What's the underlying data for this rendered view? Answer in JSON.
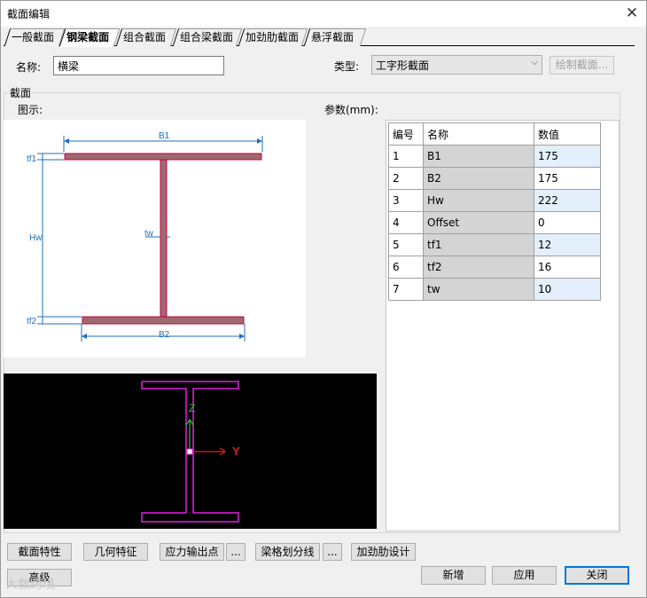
{
  "window": {
    "title": "截面编辑",
    "close": "✕"
  },
  "tabs": [
    {
      "label": "一般截面",
      "active": false
    },
    {
      "label": "钢梁截面",
      "active": true
    },
    {
      "label": "组合截面",
      "active": false
    },
    {
      "label": "组合梁截面",
      "active": false
    },
    {
      "label": "加劲肋截面",
      "active": false
    },
    {
      "label": "悬浮截面",
      "active": false
    }
  ],
  "name_field": {
    "label": "名称:",
    "value": "横梁"
  },
  "type_field": {
    "label": "类型:",
    "value": "工字形截面"
  },
  "draw_section_button": "绘制截面...",
  "section_group": {
    "title": "截面",
    "diagram_label": "图示:",
    "params_label": "参数(mm):"
  },
  "diagram": {
    "dims": {
      "B1": "B1",
      "B2": "B2",
      "Hw": "Hw",
      "tw": "tw",
      "tf1": "tf1",
      "tf2": "tf2"
    },
    "colors": {
      "flange": "#9c6a6f",
      "outline": "#cc0044",
      "dim": "#1e6fbf"
    }
  },
  "view3d": {
    "axis_z": "Z",
    "axis_y": "Y",
    "colors": {
      "outline": "#e020e0",
      "z_axis": "#22c922",
      "y_axis": "#e02020"
    }
  },
  "params_table": {
    "headers": [
      "编号",
      "名称",
      "数值"
    ],
    "rows": [
      {
        "no": "1",
        "name": "B1",
        "value": "175"
      },
      {
        "no": "2",
        "name": "B2",
        "value": "175"
      },
      {
        "no": "3",
        "name": "Hw",
        "value": "222"
      },
      {
        "no": "4",
        "name": "Offset",
        "value": "0"
      },
      {
        "no": "5",
        "name": "tf1",
        "value": "12"
      },
      {
        "no": "6",
        "name": "tf2",
        "value": "16"
      },
      {
        "no": "7",
        "name": "tw",
        "value": "10"
      }
    ]
  },
  "bottom_buttons": {
    "section_props": "截面特性",
    "geometry_props": "几何特征",
    "stress_output": "应力输出点",
    "stress_more": "...",
    "mesh_lines": "梁格划分线",
    "mesh_more": "...",
    "stiffener_design": "加劲肋设计",
    "advanced": "高级",
    "new": "新增",
    "apply": "应用",
    "close": "关闭"
  },
  "watermark": "大数跨境"
}
